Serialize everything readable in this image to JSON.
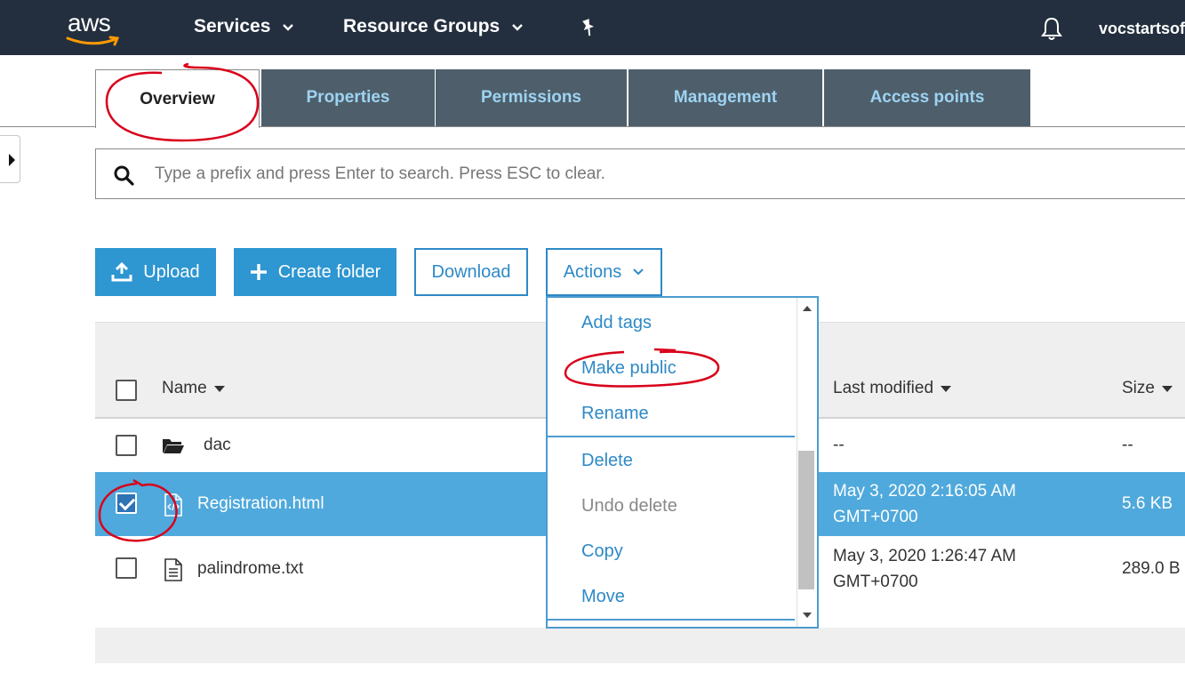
{
  "nav": {
    "logo": "aws",
    "services": "Services",
    "resource_groups": "Resource Groups",
    "account": "vocstartsof"
  },
  "tabs": [
    {
      "label": "Overview"
    },
    {
      "label": "Properties"
    },
    {
      "label": "Permissions"
    },
    {
      "label": "Management"
    },
    {
      "label": "Access points"
    }
  ],
  "search": {
    "placeholder": "Type a prefix and press Enter to search. Press ESC to clear.",
    "value": ""
  },
  "toolbar": {
    "upload": "Upload",
    "create_folder": "Create folder",
    "download": "Download",
    "actions": "Actions"
  },
  "table": {
    "columns": {
      "name": "Name",
      "last_modified": "Last modified",
      "size": "Size"
    },
    "rows": [
      {
        "name": "dac",
        "type": "folder",
        "checked": false,
        "modified_line1": "--",
        "modified_line2": "",
        "size": "--"
      },
      {
        "name": "Registration.html",
        "type": "html-file",
        "checked": true,
        "modified_line1": "May 3, 2020 2:16:05 AM",
        "modified_line2": "GMT+0700",
        "size": "5.6 KB"
      },
      {
        "name": "palindrome.txt",
        "type": "text-file",
        "checked": false,
        "modified_line1": "May 3, 2020 1:26:47 AM",
        "modified_line2": "GMT+0700",
        "size": "289.0 B"
      }
    ]
  },
  "actions_menu": {
    "items": [
      {
        "label": "Add tags",
        "enabled": true
      },
      {
        "label": "Make public",
        "enabled": true
      },
      {
        "label": "Rename",
        "enabled": true
      },
      {
        "label": "Delete",
        "enabled": true
      },
      {
        "label": "Undo delete",
        "enabled": false
      },
      {
        "label": "Copy",
        "enabled": true
      },
      {
        "label": "Move",
        "enabled": true
      }
    ]
  },
  "colors": {
    "nav_bg": "#232f3e",
    "accent": "#2e96d1",
    "selected_row": "#4fa9dc",
    "inactive_tab": "#4e5f6b",
    "annotation": "#d9001b"
  },
  "icons": [
    "aws-smile-logo",
    "chevron-down-icon",
    "pin-icon",
    "bell-icon",
    "search-icon",
    "upload-icon",
    "plus-icon",
    "folder-icon",
    "html-file-icon",
    "text-file-icon",
    "sort-down-icon"
  ]
}
